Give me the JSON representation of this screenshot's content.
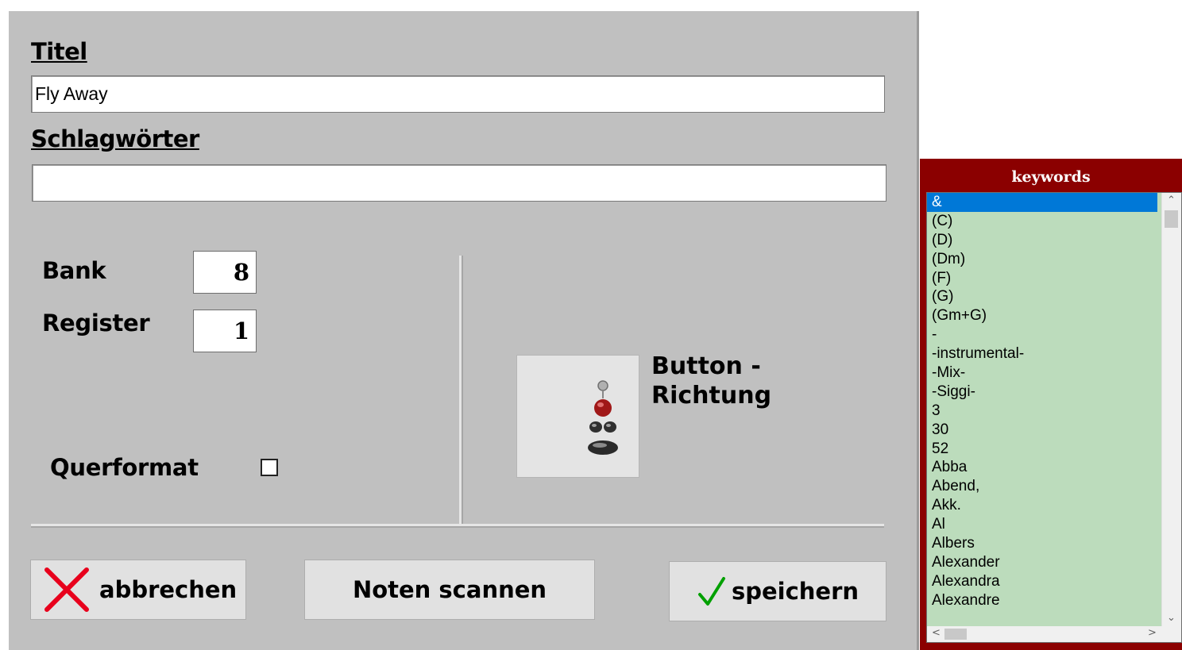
{
  "form": {
    "title_label": "Titel",
    "title_value": "Fly Away",
    "keywords_label": "Schlagwörter",
    "keywords_value": "",
    "bank_label": "Bank",
    "bank_value": "8",
    "register_label": "Register",
    "register_value": "1",
    "landscape_label": "Querformat",
    "landscape_checked": false,
    "direction_label_line1": "Button -",
    "direction_label_line2": "Richtung",
    "direction_icon": "traffic-stack-icon"
  },
  "buttons": {
    "cancel_label": "abbrechen",
    "scan_label": "Noten scannen",
    "save_label": "speichern"
  },
  "colors": {
    "dialog_bg": "#c0c0c0",
    "panel_bg": "#8b0000",
    "list_bg": "#bcdcbc",
    "selection": "#0078d7",
    "cancel_icon": "#e8001c",
    "save_icon": "#00a000"
  },
  "keywords_panel": {
    "title": "keywords",
    "items": [
      "&",
      "(C)",
      "(D)",
      "(Dm)",
      "(F)",
      "(G)",
      "(Gm+G)",
      "-",
      "-instrumental-",
      "-Mix-",
      "-Siggi-",
      "3",
      "30",
      "52",
      "Abba",
      "Abend,",
      "Akk.",
      "Al",
      "Albers",
      "Alexander",
      "Alexandra",
      "Alexandre"
    ],
    "selected_index": 0
  }
}
